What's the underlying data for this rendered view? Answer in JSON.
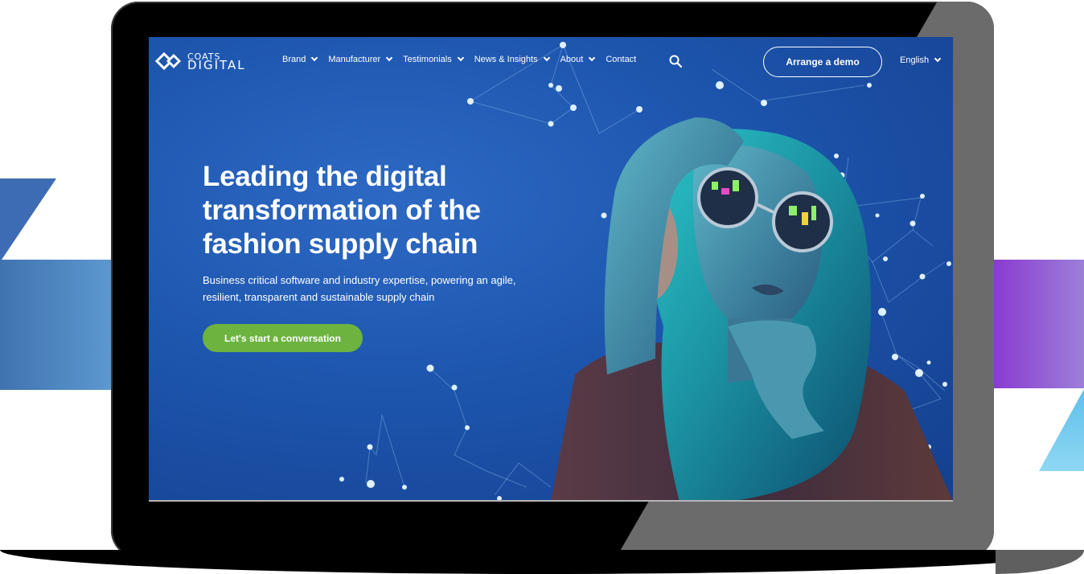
{
  "brand": {
    "logo_line1": "COATS",
    "logo_line2": "DIGITAL"
  },
  "nav": {
    "items": [
      {
        "label": "Brand",
        "has_dropdown": true
      },
      {
        "label": "Manufacturer",
        "has_dropdown": true
      },
      {
        "label": "Testimonials",
        "has_dropdown": true
      },
      {
        "label": "News & Insights",
        "has_dropdown": true
      },
      {
        "label": "About",
        "has_dropdown": true
      },
      {
        "label": "Contact",
        "has_dropdown": false
      }
    ],
    "search_icon": "search-icon",
    "demo_button": "Arrange a demo",
    "language": "English"
  },
  "hero": {
    "headline_line1": "Leading the digital",
    "headline_line2": "transformation of the",
    "headline_line3": "fashion supply chain",
    "subtext_line1": "Business critical software and industry expertise, powering an agile,",
    "subtext_line2": "resilient, transparent and sustainable supply chain",
    "cta": "Let's start a conversation"
  },
  "colors": {
    "hero_bg": "#1d55ad",
    "cta_green": "#6db33f",
    "deco_blue": "#3f73b0",
    "deco_purple": "#8a3bd0",
    "deco_cyan": "#5ec0ea"
  }
}
